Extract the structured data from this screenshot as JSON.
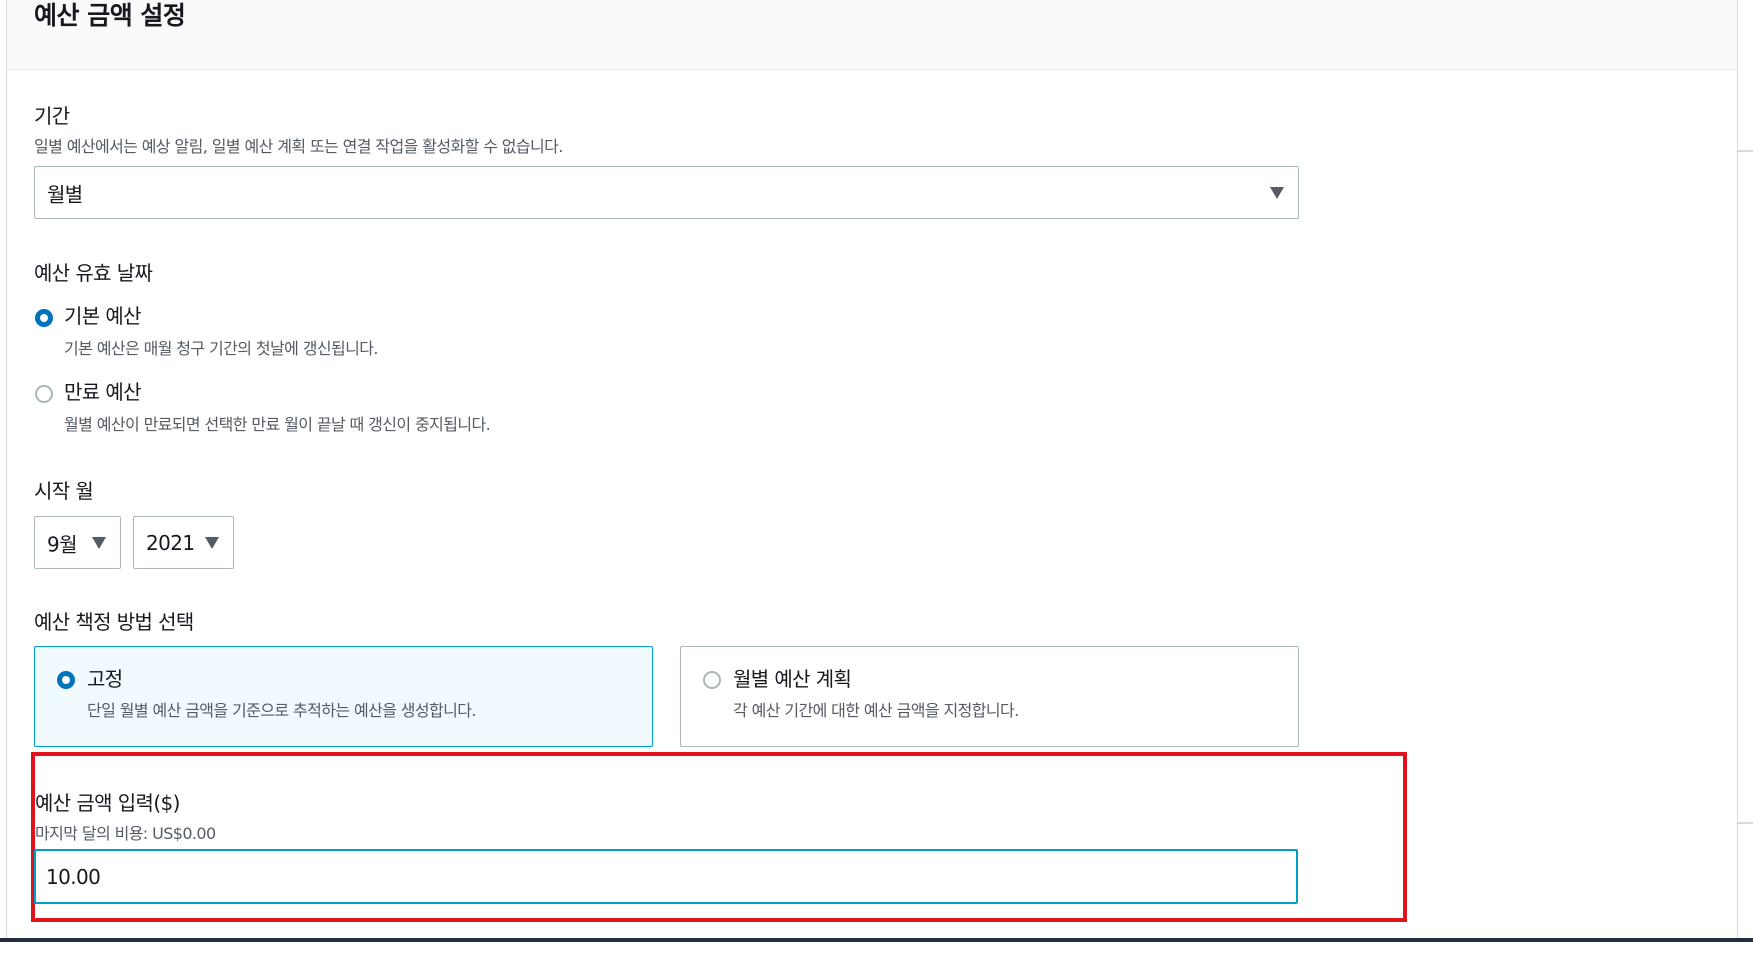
{
  "section": {
    "title": "예산 금액 설정"
  },
  "period": {
    "label": "기간",
    "description": "일별 예산에서는 예상 알림, 일별 예산 계획 또는 연결 작업을 활성화할 수 없습니다.",
    "selected": "월별"
  },
  "renewal": {
    "label": "예산 유효 날짜",
    "options": [
      {
        "label": "기본 예산",
        "description": "기본 예산은 매월 청구 기간의 첫날에 갱신됩니다.",
        "selected": true
      },
      {
        "label": "만료 예산",
        "description": "월별 예산이 만료되면 선택한 만료 월이 끝날 때 갱신이 중지됩니다.",
        "selected": false
      }
    ]
  },
  "start_month": {
    "label": "시작 월",
    "month": "9월",
    "year": "2021"
  },
  "method": {
    "label": "예산 책정 방법 선택",
    "options": [
      {
        "label": "고정",
        "description": "단일 월별 예산 금액을 기준으로 추적하는 예산을 생성합니다.",
        "selected": true
      },
      {
        "label": "월별 예산 계획",
        "description": "각 예산 기간에 대한 예산 금액을 지정합니다.",
        "selected": false
      }
    ]
  },
  "amount": {
    "label": "예산 금액 입력($)",
    "hint": "마지막 달의 비용: US$0.00",
    "value": "10.00"
  },
  "colors": {
    "accent": "#0073bb",
    "focus": "#00a1c9",
    "highlight": "#e0121c"
  }
}
